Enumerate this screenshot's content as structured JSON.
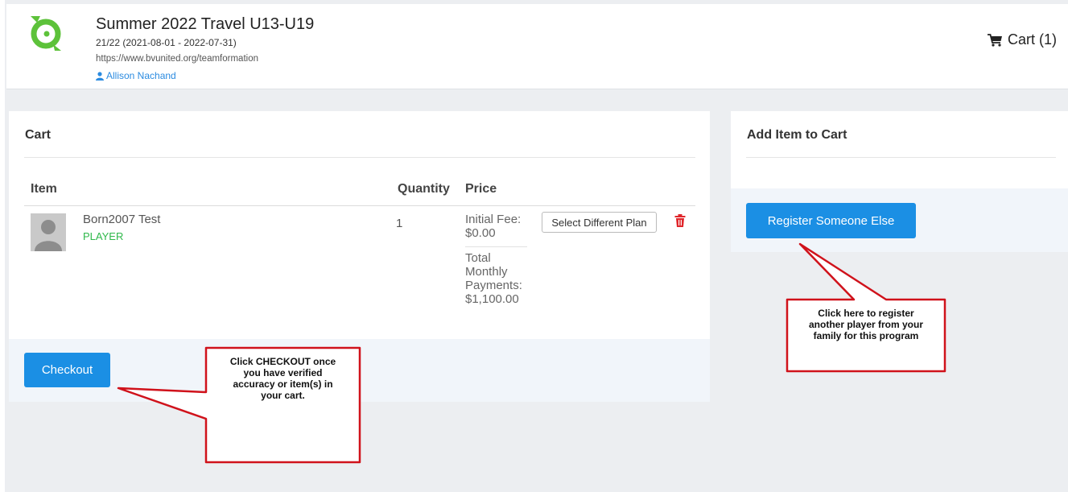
{
  "header": {
    "title": "Summer 2022 Travel U13-U19",
    "season": "21/22 (2021-08-01 - 2022-07-31)",
    "url": "https://www.bvunited.org/teamformation",
    "user": "Allison Nachand",
    "cart_label": "Cart (1)",
    "icons": {
      "logo": "brand-logo",
      "user": "user-icon",
      "cart": "cart-icon"
    }
  },
  "cart": {
    "title": "Cart",
    "columns": {
      "item": "Item",
      "quantity": "Quantity",
      "price": "Price"
    },
    "rows": [
      {
        "name": "Born2007 Test",
        "role": "PLAYER",
        "quantity": "1",
        "initial_fee_label": "Initial Fee:",
        "initial_fee_value": "$0.00",
        "monthly_line1": "Total",
        "monthly_line2": "Monthly",
        "monthly_line3": "Payments:",
        "monthly_value": "$1,100.00",
        "plan_button": "Select Different Plan"
      }
    ],
    "checkout_label": "Checkout"
  },
  "add_item": {
    "title": "Add Item to Cart",
    "register_label": "Register Someone Else"
  },
  "callouts": {
    "checkout": {
      "line1": "Click CHECKOUT once",
      "line2": "you have verified",
      "line3": "accuracy or item(s) in",
      "line4": "your cart."
    },
    "register": {
      "line1": "Click here to register",
      "line2": "another player from your",
      "line3": "family for this program"
    }
  },
  "colors": {
    "accent": "#1b8fe4",
    "link": "#2b8be0",
    "role": "#2fb84b",
    "delete": "#e0262b",
    "callout_border": "#d0121b",
    "logo": "#5dc23a"
  }
}
